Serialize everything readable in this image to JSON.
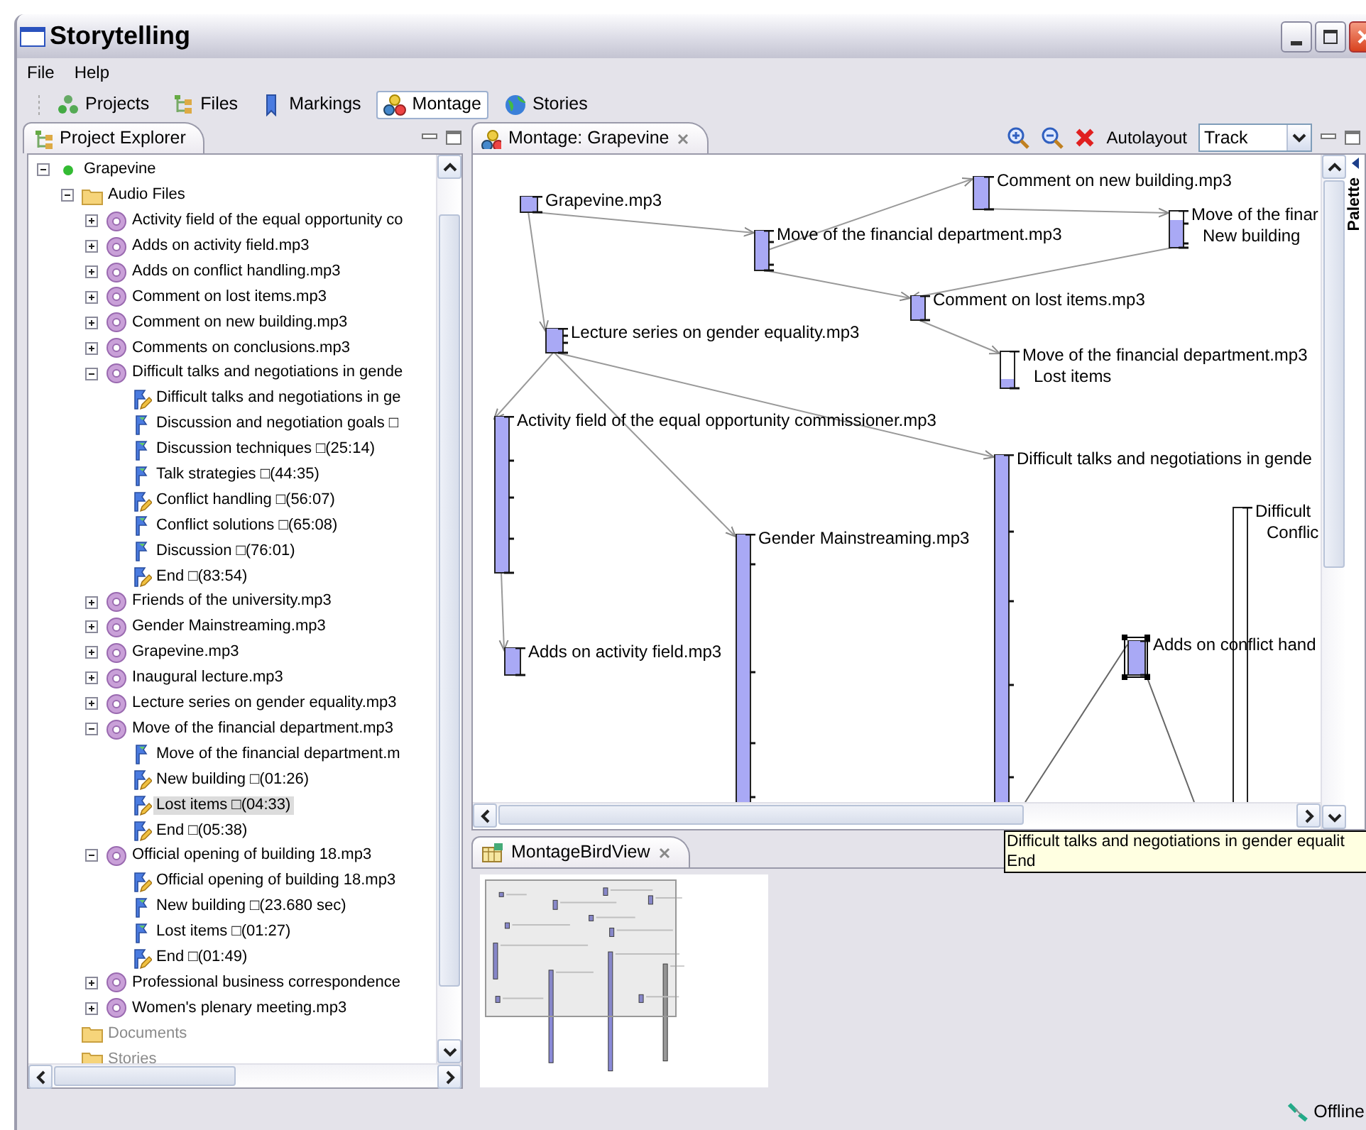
{
  "window": {
    "title": "Storytelling"
  },
  "menu": [
    "File",
    "Help"
  ],
  "perspectives": [
    {
      "label": "Projects",
      "selected": false
    },
    {
      "label": "Files",
      "selected": false
    },
    {
      "label": "Markings",
      "selected": false
    },
    {
      "label": "Montage",
      "selected": true
    },
    {
      "label": "Stories",
      "selected": false
    }
  ],
  "project_explorer": {
    "title": "Project Explorer",
    "tree": [
      {
        "label": "Grapevine",
        "kind": "project",
        "expanded": true,
        "selected": false,
        "children": [
          {
            "label": "Audio Files",
            "kind": "folder",
            "expanded": true,
            "selected": false,
            "children": [
              {
                "label": "Activity field of the equal opportunity co",
                "kind": "audio",
                "expanded": false,
                "selected": false
              },
              {
                "label": "Adds on activity field.mp3",
                "kind": "audio",
                "expanded": false,
                "selected": false
              },
              {
                "label": "Adds on conflict handling.mp3",
                "kind": "audio",
                "expanded": false,
                "selected": false
              },
              {
                "label": "Comment on lost items.mp3",
                "kind": "audio",
                "expanded": false,
                "selected": false
              },
              {
                "label": "Comment on new building.mp3",
                "kind": "audio",
                "expanded": false,
                "selected": false
              },
              {
                "label": "Comments on conclusions.mp3",
                "kind": "audio",
                "expanded": false,
                "selected": false
              },
              {
                "label": "Difficult talks and negotiations in gende",
                "kind": "audio",
                "expanded": true,
                "selected": false,
                "children": [
                  {
                    "label": "Difficult talks and negotiations in ge",
                    "kind": "edited-marker",
                    "selected": false
                  },
                  {
                    "label": "Discussion and negotiation goals □",
                    "kind": "marker",
                    "selected": false
                  },
                  {
                    "label": "Discussion techniques □(25:14)",
                    "kind": "marker",
                    "selected": false
                  },
                  {
                    "label": "Talk strategies □(44:35)",
                    "kind": "marker",
                    "selected": false
                  },
                  {
                    "label": "Conflict handling □(56:07)",
                    "kind": "edited-marker",
                    "selected": false
                  },
                  {
                    "label": "Conflict solutions □(65:08)",
                    "kind": "marker",
                    "selected": false
                  },
                  {
                    "label": "Discussion □(76:01)",
                    "kind": "marker",
                    "selected": false
                  },
                  {
                    "label": "End □(83:54)",
                    "kind": "edited-marker",
                    "selected": false
                  }
                ]
              },
              {
                "label": "Friends of the university.mp3",
                "kind": "audio",
                "expanded": false,
                "selected": false
              },
              {
                "label": "Gender Mainstreaming.mp3",
                "kind": "audio",
                "expanded": false,
                "selected": false
              },
              {
                "label": "Grapevine.mp3",
                "kind": "audio",
                "expanded": false,
                "selected": false
              },
              {
                "label": "Inaugural lecture.mp3",
                "kind": "audio",
                "expanded": false,
                "selected": false
              },
              {
                "label": "Lecture series on gender equality.mp3",
                "kind": "audio",
                "expanded": false,
                "selected": false
              },
              {
                "label": "Move of the financial department.mp3",
                "kind": "audio",
                "expanded": true,
                "selected": false,
                "children": [
                  {
                    "label": "Move of the financial department.m",
                    "kind": "marker",
                    "selected": false
                  },
                  {
                    "label": "New building □(01:26)",
                    "kind": "edited-marker",
                    "selected": false
                  },
                  {
                    "label": "Lost items □(04:33)",
                    "kind": "edited-marker",
                    "selected": true
                  },
                  {
                    "label": "End □(05:38)",
                    "kind": "edited-marker",
                    "selected": false
                  }
                ]
              },
              {
                "label": "Official opening of building 18.mp3",
                "kind": "audio",
                "expanded": true,
                "selected": false,
                "children": [
                  {
                    "label": "Official opening of building 18.mp3",
                    "kind": "edited-marker",
                    "selected": false
                  },
                  {
                    "label": "New building □(23.680 sec)",
                    "kind": "marker",
                    "selected": false
                  },
                  {
                    "label": "Lost items □(01:27)",
                    "kind": "marker",
                    "selected": false
                  },
                  {
                    "label": "End □(01:49)",
                    "kind": "edited-marker",
                    "selected": false
                  }
                ]
              },
              {
                "label": "Professional business correspondence",
                "kind": "audio",
                "expanded": false,
                "selected": false
              },
              {
                "label": "Women's plenary meeting.mp3",
                "kind": "audio",
                "expanded": false,
                "selected": false
              }
            ]
          },
          {
            "label": "Documents",
            "kind": "folder",
            "disabled": true,
            "selected": false
          },
          {
            "label": "Stories",
            "kind": "folder",
            "disabled": true,
            "selected": false
          }
        ]
      }
    ]
  },
  "montage_editor": {
    "title": "Montage: Grapevine",
    "autolayout": "Autolayout",
    "layout_mode": "Track",
    "palette": "Palette",
    "nodes": [
      {
        "lines": [
          "Grapevine.mp3"
        ],
        "selected": false
      },
      {
        "lines": [
          "Move of the financial department.mp3"
        ],
        "selected": false
      },
      {
        "lines": [
          "Comment on new building.mp3"
        ],
        "selected": false
      },
      {
        "lines": [
          "Move of the finar",
          "New building"
        ],
        "selected": false
      },
      {
        "lines": [
          "Comment on lost items.mp3"
        ],
        "selected": false
      },
      {
        "lines": [
          "Lecture series on gender equality.mp3"
        ],
        "selected": false
      },
      {
        "lines": [
          "Move of the financial department.mp3",
          "Lost items"
        ],
        "selected": false
      },
      {
        "lines": [
          "Activity field of the equal opportunity commissioner.mp3"
        ],
        "selected": false
      },
      {
        "lines": [
          "Difficult talks and negotiations in gende"
        ],
        "selected": false
      },
      {
        "lines": [
          "Gender Mainstreaming.mp3"
        ],
        "selected": false
      },
      {
        "lines": [
          "Difficult",
          "Conflic"
        ],
        "selected": false
      },
      {
        "lines": [
          "Adds on activity field.mp3"
        ],
        "selected": false
      },
      {
        "lines": [
          "Adds on conflict hand"
        ],
        "selected": true
      }
    ],
    "tooltip": [
      "Difficult talks and negotiations in gender equalit",
      "End"
    ]
  },
  "bird_view": {
    "title": "MontageBirdView"
  },
  "status_bar": {
    "connection": "Offline"
  }
}
